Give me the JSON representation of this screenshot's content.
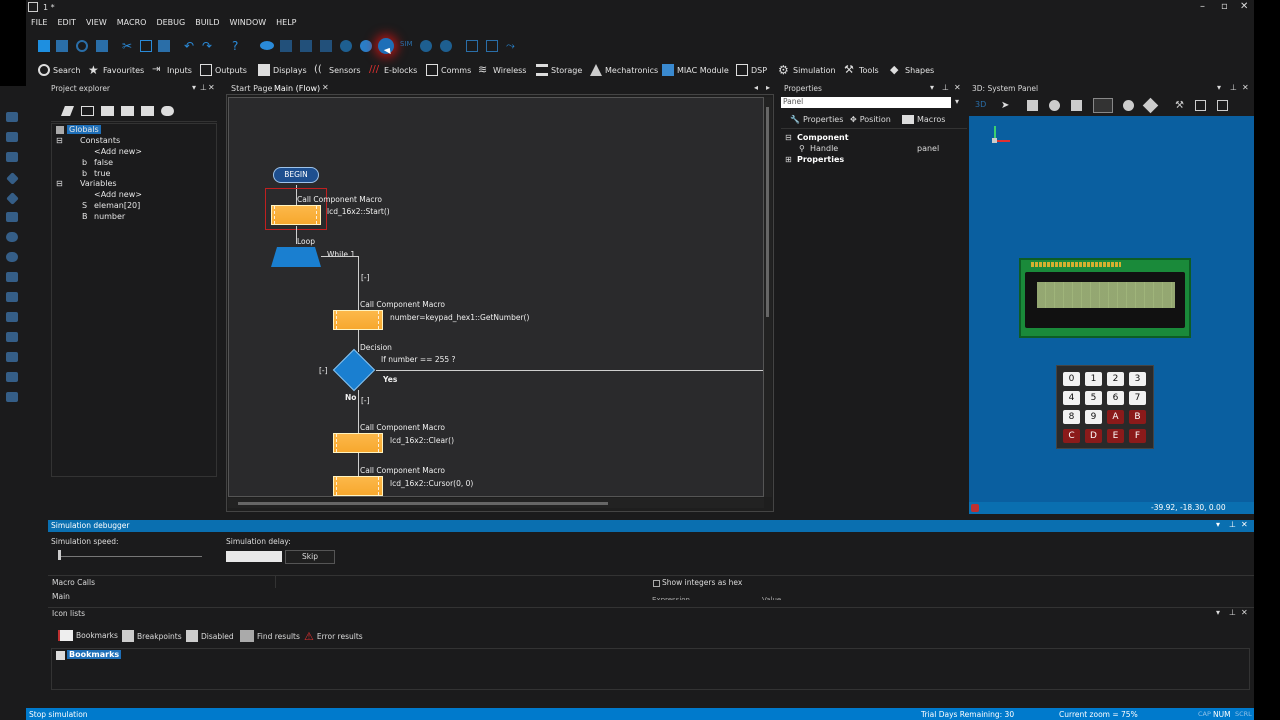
{
  "window": {
    "title": "1 *"
  },
  "menu": [
    "FILE",
    "EDIT",
    "VIEW",
    "MACRO",
    "DEBUG",
    "BUILD",
    "WINDOW",
    "HELP"
  ],
  "toolbar2": [
    {
      "label": "Search",
      "icon": "search-icon"
    },
    {
      "label": "Favourites",
      "icon": "star-icon"
    },
    {
      "label": "Inputs",
      "icon": "input-icon"
    },
    {
      "label": "Outputs",
      "icon": "output-icon"
    },
    {
      "label": "Displays",
      "icon": "display-icon"
    },
    {
      "label": "Sensors",
      "icon": "sensor-icon"
    },
    {
      "label": "E-blocks",
      "icon": "eblocks-icon"
    },
    {
      "label": "Comms",
      "icon": "comms-icon"
    },
    {
      "label": "Wireless",
      "icon": "wireless-icon"
    },
    {
      "label": "Storage",
      "icon": "storage-icon"
    },
    {
      "label": "Mechatronics",
      "icon": "mechatronics-icon"
    },
    {
      "label": "MIAC Module",
      "icon": "miac-icon"
    },
    {
      "label": "DSP",
      "icon": "dsp-icon"
    },
    {
      "label": "Simulation",
      "icon": "gear-icon"
    },
    {
      "label": "Tools",
      "icon": "tools-icon"
    },
    {
      "label": "Shapes",
      "icon": "shapes-icon"
    }
  ],
  "project_explorer": {
    "title": "Project explorer",
    "tree": {
      "globals": "Globals",
      "constants": "Constants",
      "add_new_1": "<Add new>",
      "false": "false",
      "true": "true",
      "variables": "Variables",
      "add_new_2": "<Add new>",
      "eleman": "eleman[20]",
      "number": "number"
    }
  },
  "tabs": {
    "start": "Start Page",
    "main": "Main (Flow)"
  },
  "flow": {
    "begin": "BEGIN",
    "call1_title": "Call Component Macro",
    "call1_text": "lcd_16x2::Start()",
    "loop": "Loop",
    "while": "While 1",
    "collapse1": "[-]",
    "call2_title": "Call Component Macro",
    "call2_text": "number=keypad_hex1::GetNumber()",
    "decision": "Decision",
    "decision_text": "If number == 255 ?",
    "collapse2": "[-]",
    "yes": "Yes",
    "no": "No",
    "collapse3": "[-]",
    "call3_title": "Call Component Macro",
    "call3_text": "lcd_16x2::Clear()",
    "call4_title": "Call Component Macro",
    "call4_text": "lcd_16x2::Cursor(0, 0)"
  },
  "properties": {
    "title": "Properties",
    "combo": "Panel",
    "tabs": [
      "Properties",
      "Position",
      "Macros"
    ],
    "component": "Component",
    "handle_label": "Handle",
    "handle_value": "panel",
    "properties": "Properties"
  },
  "system_panel": {
    "title": "3D: System Panel",
    "coords": "-39.92, -18.30, 0.00",
    "keys": [
      "0",
      "1",
      "2",
      "3",
      "4",
      "5",
      "6",
      "7",
      "8",
      "9",
      "A",
      "B",
      "C",
      "D",
      "E",
      "F"
    ]
  },
  "sim_debugger": {
    "title": "Simulation debugger",
    "speed_label": "Simulation speed:",
    "delay_label": "Simulation delay:",
    "skip": "Skip",
    "macro_calls": "Macro Calls",
    "show_hex": "Show integers as hex",
    "main": "Main",
    "expression": "Expression",
    "value": "Value"
  },
  "icon_lists": {
    "title": "Icon lists",
    "tabs": [
      "Bookmarks",
      "Breakpoints",
      "Disabled",
      "Find results",
      "Error results"
    ],
    "selected": "Bookmarks"
  },
  "status": {
    "left": "Stop simulation",
    "trial": "Trial Days Remaining: 30",
    "zoom": "Current zoom = 75%",
    "cap": "CAP",
    "num": "NUM",
    "scrl": "SCRL"
  }
}
